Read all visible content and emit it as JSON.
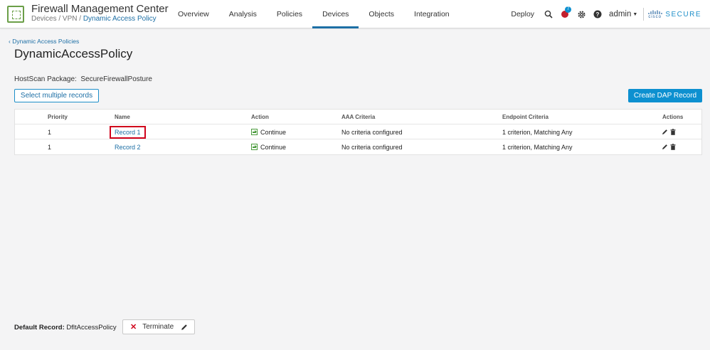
{
  "header": {
    "title": "Firewall Management Center",
    "breadcrumb": {
      "part1": "Devices",
      "part2": "VPN",
      "current": "Dynamic Access Policy",
      "sep": " / "
    },
    "nav": [
      "Overview",
      "Analysis",
      "Policies",
      "Devices",
      "Objects",
      "Integration"
    ],
    "active_nav": "Devices",
    "deploy_label": "Deploy",
    "notification_count": "7",
    "user": "admin",
    "cisco_label": "cisco",
    "secure_label": "SECURE"
  },
  "page": {
    "back_link": "Dynamic Access Policies",
    "title": "DynamicAccessPolicy",
    "hostscan_label": "HostScan Package:",
    "hostscan_value": "SecureFirewallPosture",
    "select_multiple_label": "Select multiple records",
    "create_label": "Create DAP Record"
  },
  "table": {
    "headers": {
      "priority": "Priority",
      "name": "Name",
      "action": "Action",
      "aaa": "AAA Criteria",
      "endpoint": "Endpoint Criteria",
      "actions": "Actions"
    },
    "rows": [
      {
        "priority": "1",
        "name": "Record 1",
        "action": "Continue",
        "aaa": "No criteria configured",
        "endpoint": "1 criterion, Matching Any"
      },
      {
        "priority": "1",
        "name": "Record 2",
        "action": "Continue",
        "aaa": "No criteria configured",
        "endpoint": "1 criterion, Matching Any"
      }
    ]
  },
  "footer": {
    "default_record_label": "Default Record:",
    "default_record_value": "DfltAccessPolicy",
    "terminate_label": "Terminate"
  },
  "colors": {
    "accent": "#0d90d0",
    "link": "#1d6fa5",
    "highlight": "#d0021b",
    "continue": "#4a9b3c",
    "logo": "#6b9f48"
  }
}
